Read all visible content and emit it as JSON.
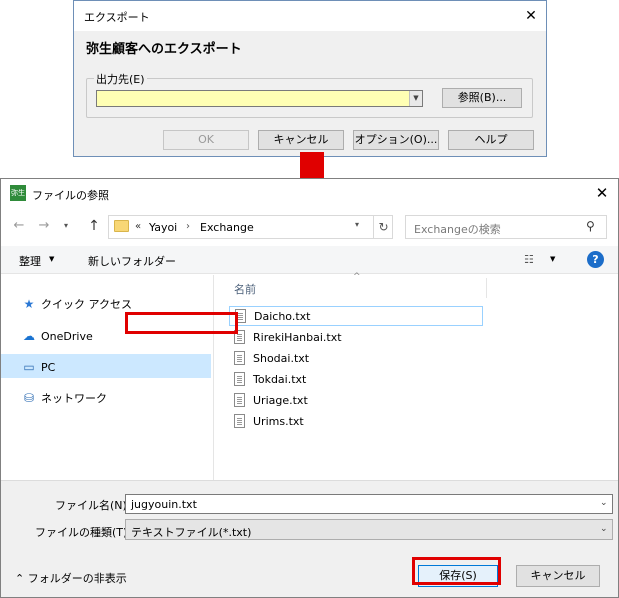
{
  "export_dialog": {
    "title": "エクスポート",
    "close_glyph": "✕",
    "heading": "弥生顧客へのエクスポート",
    "group_label": "出力先(E)",
    "path_value": "",
    "browse_label": "参照(B)...",
    "ok_label": "OK",
    "cancel_label": "キャンセル",
    "option_label": "オプション(O)...",
    "help_label": "ヘルプ",
    "path_background": "#ffffb4"
  },
  "annotation": {
    "arrow_color": "#e00000",
    "highlight_color": "#e00000"
  },
  "file_dialog": {
    "app_icon_text": "弥生",
    "title": "ファイルの参照",
    "close_glyph": "✕",
    "nav": {
      "back": "←",
      "forward": "→",
      "recent": "▾",
      "up": "↑"
    },
    "address": {
      "chevron": "«",
      "crumbs": [
        "Yayoi",
        "Exchange"
      ],
      "separator": "›",
      "dropdown": "▾",
      "refresh": "↻"
    },
    "search": {
      "placeholder": "Exchangeの検索",
      "icon": "⚲"
    },
    "toolbar": {
      "organize": "整理",
      "organize_dd": "▼",
      "new_folder": "新しいフォルダー",
      "view_icon": "☷",
      "view_dd": "▼",
      "help": "?"
    },
    "nav_pane": {
      "items": [
        {
          "label": "クイック アクセス",
          "icon": "★"
        },
        {
          "label": "OneDrive",
          "icon": "☁"
        },
        {
          "label": "PC",
          "icon": "▭"
        },
        {
          "label": "ネットワーク",
          "icon": "⛁"
        }
      ]
    },
    "file_list": {
      "column_name": "名前",
      "sort_indicator": "^",
      "files": [
        "Daicho.txt",
        "RirekiHanbai.txt",
        "Shodai.txt",
        "Tokdai.txt",
        "Uriage.txt",
        "Urims.txt"
      ]
    },
    "bottom": {
      "filename_label": "ファイル名(N):",
      "filename_value": "jugyouin.txt",
      "dd_glyph": "⌄",
      "filetype_label": "ファイルの種類(T):",
      "filetype_value": "テキストファイル(*.txt)",
      "hide_folders": "⌃ フォルダーの非表示",
      "save_label": "保存(S)",
      "cancel_label": "キャンセル"
    }
  }
}
